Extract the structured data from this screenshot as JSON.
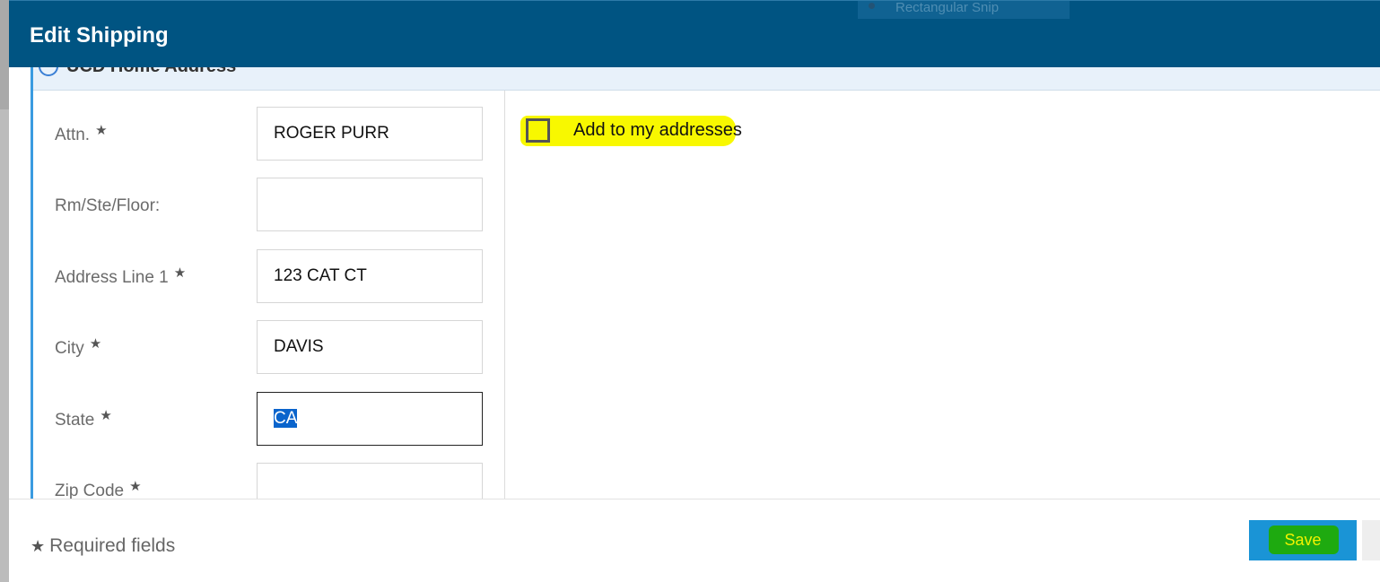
{
  "modal": {
    "title": "Edit Shipping"
  },
  "overlay": {
    "snip_label": "Rectangular Snip"
  },
  "section": {
    "title": "UCD Home Address"
  },
  "form": {
    "fields": [
      {
        "label": "Attn.",
        "required": true,
        "value": "ROGER PURR"
      },
      {
        "label": "Rm/Ste/Floor:",
        "required": false,
        "value": ""
      },
      {
        "label": "Address Line 1",
        "required": true,
        "value": "123 CAT CT"
      },
      {
        "label": "City",
        "required": true,
        "value": "DAVIS"
      },
      {
        "label": "State",
        "required": true,
        "value": "CA"
      },
      {
        "label": "Zip Code",
        "required": true,
        "value": ""
      }
    ],
    "required_star": "★"
  },
  "options": {
    "add_to_addresses_label": "Add to my addresses",
    "add_to_addresses_checked": false
  },
  "footer": {
    "required_note": "Required fields",
    "save_label": "Save"
  },
  "colors": {
    "header_bg": "#005482",
    "accent_border": "#3a9be0",
    "save_button": "#1a94d6",
    "highlight_yellow": "#f8f800",
    "highlight_green": "#1eaa10"
  }
}
